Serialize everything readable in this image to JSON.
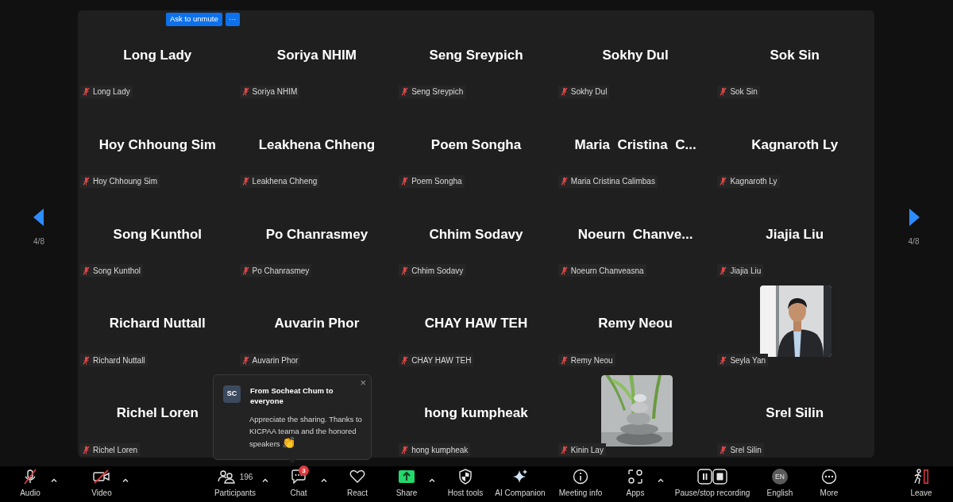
{
  "gallery": {
    "hover_controls": {
      "ask_button": "Ask to unmute",
      "more_button": "···"
    },
    "tiles": [
      {
        "kind": "name",
        "display_name": "Long Lady",
        "label": "Long Lady"
      },
      {
        "kind": "name",
        "display_name": "Soriya NHIM",
        "label": "Soriya NHIM"
      },
      {
        "kind": "name",
        "display_name": "Seng Sreypich",
        "label": "Seng Sreypich"
      },
      {
        "kind": "name",
        "display_name": "Sokhy Dul",
        "label": "Sokhy Dul"
      },
      {
        "kind": "name",
        "display_name": "Sok Sin",
        "label": "Sok Sin"
      },
      {
        "kind": "name",
        "display_name": "Hoy Chhoung Sim",
        "label": "Hoy Chhoung Sim"
      },
      {
        "kind": "name",
        "display_name": "Leakhena Chheng",
        "label": "Leakhena Chheng"
      },
      {
        "kind": "name",
        "display_name": "Poem Songha",
        "label": "Poem Songha"
      },
      {
        "kind": "name",
        "display_name": "Maria  Cristina  C...",
        "label": "Maria Cristina Calimbas"
      },
      {
        "kind": "name",
        "display_name": "Kagnaroth Ly",
        "label": "Kagnaroth Ly"
      },
      {
        "kind": "name",
        "display_name": "Song Kunthol",
        "label": "Song Kunthol"
      },
      {
        "kind": "name",
        "display_name": "Po Chanrasmey",
        "label": "Po Chanrasmey"
      },
      {
        "kind": "name",
        "display_name": "Chhim Sodavy",
        "label": "Chhim Sodavy"
      },
      {
        "kind": "name",
        "display_name": "Noeurn  Chanve...",
        "label": "Noeurn Chanveasna"
      },
      {
        "kind": "name",
        "display_name": "Jiajia Liu",
        "label": "Jiajia Liu"
      },
      {
        "kind": "name",
        "display_name": "Richard Nuttall",
        "label": "Richard Nuttall"
      },
      {
        "kind": "name",
        "display_name": "Auvarin Phor",
        "label": "Auvarin Phor"
      },
      {
        "kind": "name",
        "display_name": "CHAY HAW TEH",
        "label": "CHAY HAW TEH"
      },
      {
        "kind": "name",
        "display_name": "Remy Neou",
        "label": "Remy Neou"
      },
      {
        "kind": "person_photo",
        "label": "Seyla Yan"
      },
      {
        "kind": "name",
        "display_name": "Richel Loren",
        "label": "Richel Loren"
      },
      {
        "kind": "covered"
      },
      {
        "kind": "name",
        "display_name": "hong kumpheak",
        "label": "hong kumpheak"
      },
      {
        "kind": "stones_photo",
        "label": "Kinin Lay"
      },
      {
        "kind": "name",
        "display_name": "Srel Silin",
        "label": "Srel Silin"
      }
    ],
    "pager": {
      "left": "4/8",
      "right": "4/8"
    }
  },
  "chat_popup": {
    "avatar": "SC",
    "title": "From Socheat Chum to everyone",
    "message": "Appreciate the sharing. Thanks to KICPAA teama and the honored speakers",
    "emoji": "👏",
    "close": "×"
  },
  "toolbar": {
    "left": [
      {
        "kind": "audio",
        "label": "Audio",
        "caret": true
      },
      {
        "kind": "video",
        "label": "Video",
        "caret": true
      }
    ],
    "center": [
      {
        "kind": "participants",
        "label": "Participants",
        "count": "196",
        "caret": true
      },
      {
        "kind": "chat",
        "label": "Chat",
        "badge": "3",
        "caret": true
      },
      {
        "kind": "react",
        "label": "React"
      },
      {
        "kind": "share",
        "label": "Share",
        "caret": true
      },
      {
        "kind": "host",
        "label": "Host tools"
      },
      {
        "kind": "ai",
        "label": "AI Companion"
      },
      {
        "kind": "info",
        "label": "Meeting info"
      },
      {
        "kind": "apps",
        "label": "Apps",
        "caret": true
      },
      {
        "kind": "record",
        "label": "Pause/stop recording"
      },
      {
        "kind": "language",
        "label": "English",
        "code": "EN"
      },
      {
        "kind": "more",
        "label": "More"
      }
    ],
    "right": [
      {
        "kind": "leave",
        "label": "Leave"
      }
    ]
  }
}
